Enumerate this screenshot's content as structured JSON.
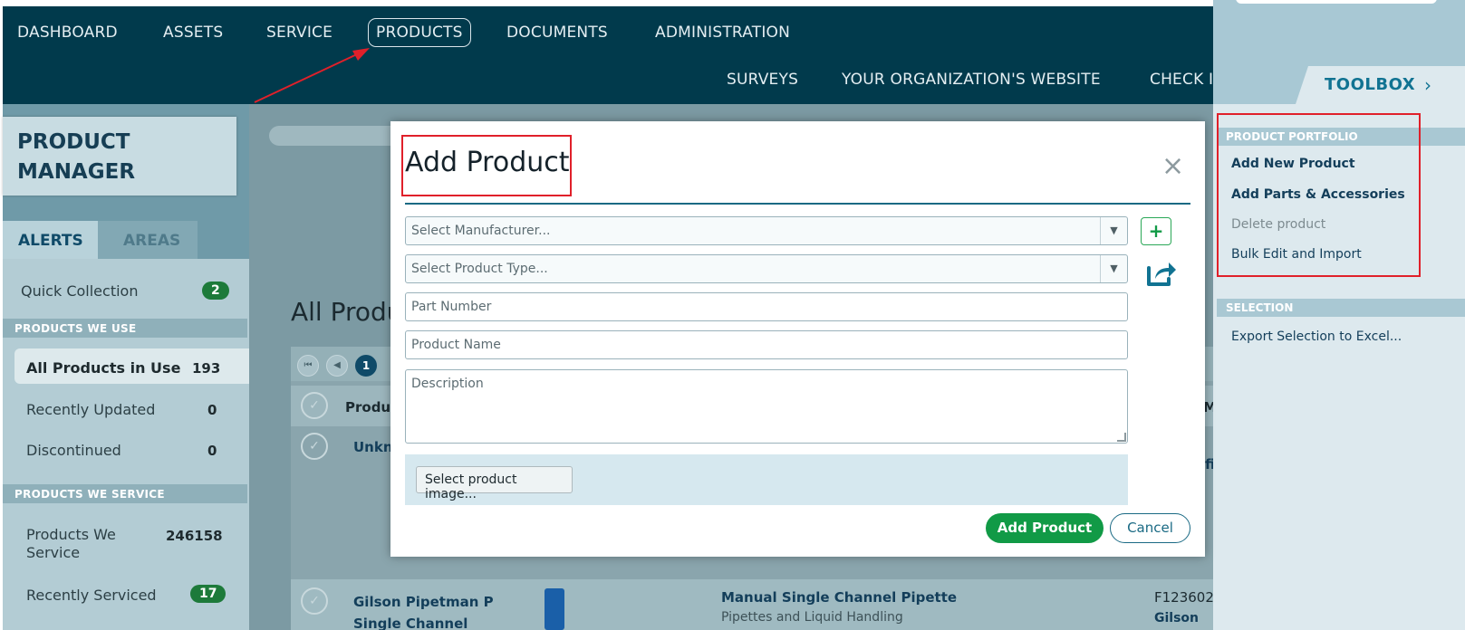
{
  "nav": {
    "row1": [
      "DASHBOARD",
      "ASSETS",
      "SERVICE",
      "PRODUCTS",
      "DOCUMENTS",
      "ADMINISTRATION"
    ],
    "row2": [
      "SURVEYS",
      "YOUR ORGANIZATION'S WEBSITE",
      "CHECK I"
    ]
  },
  "product_manager": {
    "title_line1": "PRODUCT",
    "title_line2": "MANAGER"
  },
  "tabs": {
    "alerts": "ALERTS",
    "areas": "AREAS"
  },
  "sidebar": {
    "quick_collection": {
      "label": "Quick Collection",
      "count": "2"
    },
    "section_use": "PRODUCTS WE USE",
    "use_items": [
      {
        "label": "All Products in Use",
        "count": "193"
      },
      {
        "label": "Recently Updated",
        "count": "0"
      },
      {
        "label": "Discontinued",
        "count": "0"
      }
    ],
    "section_service": "PRODUCTS WE SERVICE",
    "service_items": [
      {
        "label_line1": "Products We",
        "label_line2": "Service",
        "count": "246158"
      },
      {
        "label": "Recently Serviced",
        "count": "17"
      }
    ]
  },
  "main": {
    "title": "All Produ",
    "page_current": "1",
    "table_header_product": "Product",
    "row1_name": "Unkno",
    "row1_right": "fi",
    "row2": {
      "name_line1": "Gilson Pipetman P",
      "name_line2": "Single Channel",
      "type_title": "Manual Single Channel Pipette",
      "type_sub": "Pipettes and Liquid Handling",
      "part": "F123602",
      "manufacturer": "Gilson"
    },
    "header_right": "M"
  },
  "toolbox": {
    "label": "TOOLBOX",
    "section_portfolio": "PRODUCT PORTFOLIO",
    "portfolio_items": [
      "Add New Product",
      "Add Parts & Accessories",
      "Delete product",
      "Bulk Edit and Import"
    ],
    "section_selection": "SELECTION",
    "selection_items": [
      "Export Selection to Excel..."
    ]
  },
  "modal": {
    "title": "Add Product",
    "close_symbol": "×",
    "manufacturer_placeholder": "Select Manufacturer...",
    "product_type_placeholder": "Select Product Type...",
    "part_number_placeholder": "Part Number",
    "product_name_placeholder": "Product Name",
    "description_placeholder": "Description",
    "select_image_label": "Select product image...",
    "add_button": "Add Product",
    "cancel_button": "Cancel",
    "plus_symbol": "+"
  },
  "colors": {
    "nav_bg": "#013a4c",
    "accent_green": "#119a46",
    "accent_blue": "#117392",
    "highlight_red": "#e0202a"
  },
  "icons": [
    "plus-icon",
    "share-icon",
    "close-icon",
    "chevron-right-icon",
    "dropdown-arrow-icon",
    "check-circle-icon",
    "pager-first-icon",
    "pager-prev-icon"
  ]
}
